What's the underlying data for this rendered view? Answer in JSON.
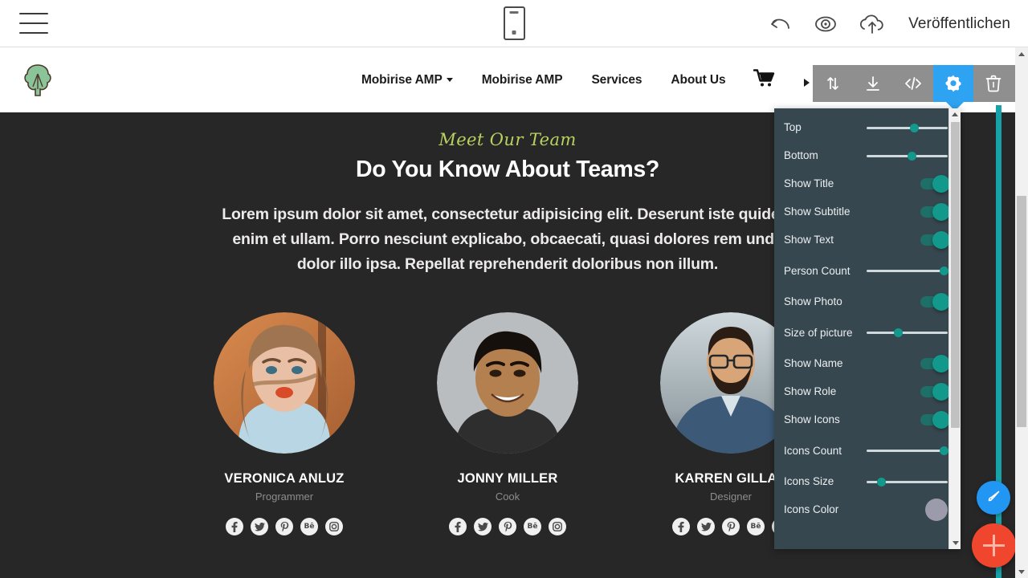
{
  "app_header": {
    "menu_icon": "hamburger-icon",
    "device_icon": "mobile-device-icon",
    "undo_icon": "undo-icon",
    "preview_icon": "eye-preview-icon",
    "publish_icon": "cloud-upload-icon",
    "publish_label": "Veröffentlichen"
  },
  "site_nav": {
    "logo": "tree-logo-icon",
    "cart_icon": "shopping-cart-icon",
    "links": [
      {
        "label": "Mobirise AMP",
        "has_caret": true
      },
      {
        "label": "Mobirise AMP",
        "has_caret": false
      },
      {
        "label": "Services",
        "has_caret": false
      },
      {
        "label": "About Us",
        "has_caret": false
      }
    ]
  },
  "block_toolbar": {
    "buttons": [
      {
        "name": "move-block-button",
        "icon": "arrows-up-down-icon",
        "active": false
      },
      {
        "name": "save-block-button",
        "icon": "download-icon",
        "active": false
      },
      {
        "name": "edit-code-button",
        "icon": "code-brackets-icon",
        "active": false
      },
      {
        "name": "block-settings-button",
        "icon": "gear-icon",
        "active": true
      },
      {
        "name": "delete-block-button",
        "icon": "trash-icon",
        "active": false
      }
    ]
  },
  "team_section": {
    "kicker": "Meet Our Team",
    "title": "Do You Know About Teams?",
    "text": "Lorem ipsum dolor sit amet, consectetur adipisicing elit. Deserunt iste quidem enim et ullam. Porro nesciunt explicabo, obcaecati, quasi dolores rem unde dolor illo ipsa. Repellat reprehenderit doloribus non illum.",
    "members": [
      {
        "name": "VERONICA ANLUZ",
        "role": "Programmer",
        "photo": "woman-portrait-photo",
        "socials": [
          "facebook-icon",
          "twitter-icon",
          "pinterest-icon",
          "behance-icon",
          "instagram-icon"
        ]
      },
      {
        "name": "JONNY MILLER",
        "role": "Cook",
        "photo": "man-portrait-photo",
        "socials": [
          "facebook-icon",
          "twitter-icon",
          "pinterest-icon",
          "behance-icon",
          "instagram-icon"
        ]
      },
      {
        "name": "KARREN GILLAN",
        "role": "Designer",
        "photo": "bearded-man-photo",
        "socials": [
          "facebook-icon",
          "twitter-icon",
          "pinterest-icon",
          "behance-icon",
          "instagram-icon"
        ]
      }
    ]
  },
  "settings_panel": {
    "accent_color": "#12998c",
    "background_color": "#37474f",
    "rows": [
      {
        "label": "Top",
        "type": "slider",
        "value": 60
      },
      {
        "label": "Bottom",
        "type": "slider",
        "value": 57
      },
      {
        "label": "Show Title",
        "type": "toggle",
        "value": true
      },
      {
        "label": "Show Subtitle",
        "type": "toggle",
        "value": true
      },
      {
        "label": "Show Text",
        "type": "toggle",
        "value": true
      },
      {
        "label": "Person Count",
        "type": "slider",
        "value": 95
      },
      {
        "label": "Show Photo",
        "type": "toggle",
        "value": true
      },
      {
        "label": "Size of picture",
        "type": "slider",
        "value": 38
      },
      {
        "label": "Show Name",
        "type": "toggle",
        "value": true
      },
      {
        "label": "Show Role",
        "type": "toggle",
        "value": true
      },
      {
        "label": "Show Icons",
        "type": "toggle",
        "value": true
      },
      {
        "label": "Icons Count",
        "type": "slider",
        "value": 95
      },
      {
        "label": "Icons Size",
        "type": "slider",
        "value": 17
      },
      {
        "label": "Icons Color",
        "type": "color",
        "value": "#9b9bab"
      }
    ]
  },
  "fabs": {
    "brush": {
      "icon": "paint-brush-icon",
      "color": "#2196f3"
    },
    "add": {
      "icon": "plus-icon",
      "color": "#f0462d"
    }
  }
}
